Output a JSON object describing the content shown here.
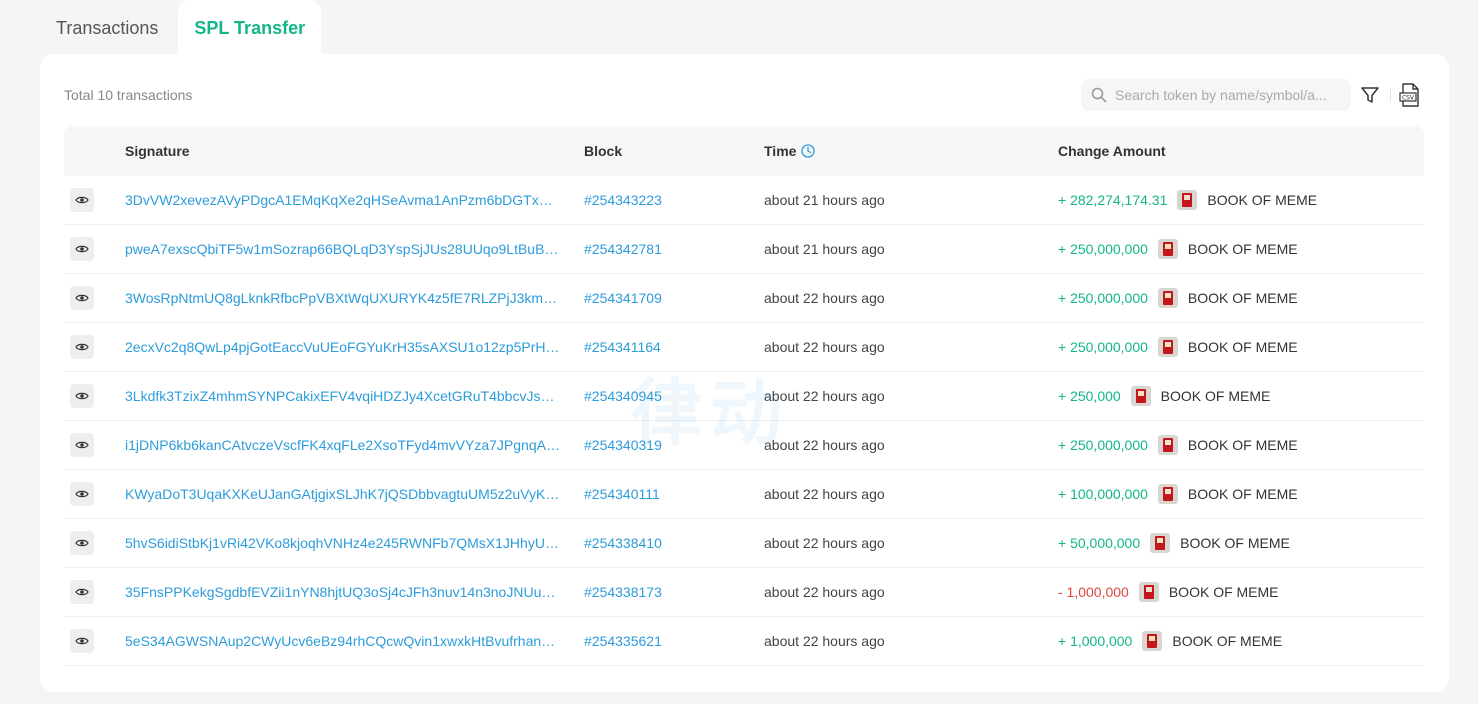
{
  "tabs": [
    {
      "label": "Transactions",
      "active": false
    },
    {
      "label": "SPL Transfer",
      "active": true
    }
  ],
  "toolbar": {
    "total_label": "Total 10 transactions",
    "search_placeholder": "Search token by name/symbol/a..."
  },
  "table": {
    "headers": {
      "signature": "Signature",
      "block": "Block",
      "time": "Time",
      "change": "Change Amount"
    },
    "rows": [
      {
        "signature": "3DvVW2xevezAVyPDgcA1EMqKqXe2qHSeAvma1AnPzm6bDGTx66...",
        "block": "#254343223",
        "time": "about 21 hours ago",
        "amount": "+ 282,274,174.31",
        "direction": "in",
        "token": "BOOK OF MEME"
      },
      {
        "signature": "pweA7exscQbiTF5w1mSozrap66BQLqD3YspSjJUs28UUqo9LtBuBA...",
        "block": "#254342781",
        "time": "about 21 hours ago",
        "amount": "+ 250,000,000",
        "direction": "in",
        "token": "BOOK OF MEME"
      },
      {
        "signature": "3WosRpNtmUQ8gLknkRfbcPpVBXtWqUXURYK4z5fE7RLZPjJ3kmua...",
        "block": "#254341709",
        "time": "about 22 hours ago",
        "amount": "+ 250,000,000",
        "direction": "in",
        "token": "BOOK OF MEME"
      },
      {
        "signature": "2ecxVc2q8QwLp4pjGotEaccVuUEoFGYuKrH35sAXSU1o12zp5PrHF...",
        "block": "#254341164",
        "time": "about 22 hours ago",
        "amount": "+ 250,000,000",
        "direction": "in",
        "token": "BOOK OF MEME"
      },
      {
        "signature": "3Lkdfk3TzixZ4mhmSYNPCakixEFV4vqiHDZJy4XcetGRuT4bbcvJsed...",
        "block": "#254340945",
        "time": "about 22 hours ago",
        "amount": "+ 250,000",
        "direction": "in",
        "token": "BOOK OF MEME"
      },
      {
        "signature": "i1jDNP6kb6kanCAtvczeVscfFK4xqFLe2XsoTFyd4mvVYza7JPgnqAr...",
        "block": "#254340319",
        "time": "about 22 hours ago",
        "amount": "+ 250,000,000",
        "direction": "in",
        "token": "BOOK OF MEME"
      },
      {
        "signature": "KWyaDoT3UqaKXKeUJanGAtjgixSLJhK7jQSDbbvagtuUM5z2uVyKvj...",
        "block": "#254340111",
        "time": "about 22 hours ago",
        "amount": "+ 100,000,000",
        "direction": "in",
        "token": "BOOK OF MEME"
      },
      {
        "signature": "5hvS6idiStbKj1vRi42VKo8kjoqhVNHz4e245RWNFb7QMsX1JHhyUA...",
        "block": "#254338410",
        "time": "about 22 hours ago",
        "amount": "+ 50,000,000",
        "direction": "in",
        "token": "BOOK OF MEME"
      },
      {
        "signature": "35FnsPPKekgSgdbfEVZii1nYN8hjtUQ3oSj4cJFh3nuv14n3noJNUu5...",
        "block": "#254338173",
        "time": "about 22 hours ago",
        "amount": "- 1,000,000",
        "direction": "out",
        "token": "BOOK OF MEME"
      },
      {
        "signature": "5eS34AGWSNAup2CWyUcv6eBz94rhCQcwQvin1xwxkHtBvufrhan3x...",
        "block": "#254335621",
        "time": "about 22 hours ago",
        "amount": "+ 1,000,000",
        "direction": "in",
        "token": "BOOK OF MEME"
      }
    ]
  },
  "watermark": "律动",
  "colors": {
    "accent": "#14b58a",
    "link": "#2d9cdb",
    "negative": "#e0463f"
  },
  "icons": {
    "search": "search-icon",
    "filter": "filter-icon",
    "csv": "csv-export-icon",
    "view": "eye-icon",
    "time_info": "clock-icon",
    "token": "book-of-meme-token-icon"
  }
}
